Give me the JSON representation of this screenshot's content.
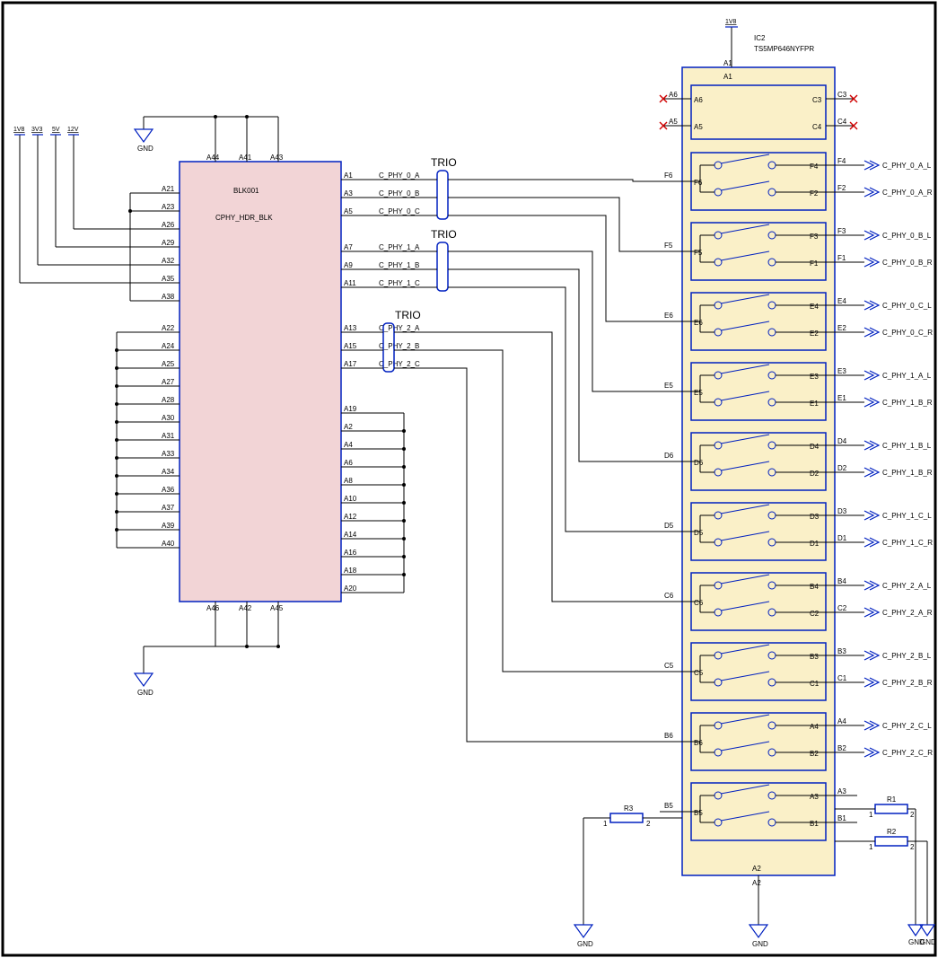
{
  "power_rails": [
    "1V8",
    "3V3",
    "5V",
    "12V"
  ],
  "gnd_label": "GND",
  "block_left": {
    "refdes": "BLK001",
    "type": "CPHY_HDR_BLK",
    "left_pins_top": [
      "A21",
      "A23",
      "A26",
      "A29",
      "A32",
      "A35",
      "A38"
    ],
    "left_pins_bottom": [
      "A22",
      "A24",
      "A25",
      "A27",
      "A28",
      "A30",
      "A31",
      "A33",
      "A34",
      "A36",
      "A37",
      "A39",
      "A40"
    ],
    "right_pins_trios": [
      "A1",
      "A3",
      "A5",
      "A7",
      "A9",
      "A11",
      "A13",
      "A15",
      "A17"
    ],
    "right_pins_bottom": [
      "A19",
      "A2",
      "A4",
      "A6",
      "A8",
      "A10",
      "A12",
      "A14",
      "A16",
      "A18",
      "A20"
    ],
    "top_pins": [
      "A44",
      "A41",
      "A43"
    ],
    "bottom_pins": [
      "A46",
      "A42",
      "A45"
    ]
  },
  "trio_label": "TRIO",
  "cphy_nets": [
    "C_PHY_0_A",
    "C_PHY_0_B",
    "C_PHY_0_C",
    "C_PHY_1_A",
    "C_PHY_1_B",
    "C_PHY_1_C",
    "C_PHY_2_A",
    "C_PHY_2_B",
    "C_PHY_2_C"
  ],
  "ic_right": {
    "refdes": "IC2",
    "part": "TS5MP646NYFPR",
    "top_pin": "A1",
    "bottom_pin": "A2",
    "power_top": "1V8",
    "nc_left": [
      "A6",
      "A5"
    ],
    "nc_right": [
      "C3",
      "C4"
    ],
    "left_inputs": [
      "F6",
      "F5",
      "E6",
      "E5",
      "D6",
      "D5",
      "C6",
      "C5",
      "B6",
      "B5"
    ],
    "right_outputs": [
      [
        "F4",
        "F2"
      ],
      [
        "F3",
        "F1"
      ],
      [
        "E4",
        "E2"
      ],
      [
        "E3",
        "E1"
      ],
      [
        "D4",
        "D2"
      ],
      [
        "D3",
        "D1"
      ],
      [
        "B4",
        "C2"
      ],
      [
        "B3",
        "C1"
      ],
      [
        "A4",
        "B2"
      ],
      [
        "A3",
        "B1"
      ]
    ]
  },
  "out_ports": [
    "C_PHY_0_A_L",
    "C_PHY_0_A_R",
    "C_PHY_0_B_L",
    "C_PHY_0_B_R",
    "C_PHY_0_C_L",
    "C_PHY_0_C_R",
    "C_PHY_1_A_L",
    "C_PHY_1_B_R",
    "C_PHY_1_B_L",
    "C_PHY_1_B_R",
    "C_PHY_1_C_L",
    "C_PHY_1_C_R",
    "C_PHY_2_A_L",
    "C_PHY_2_A_R",
    "C_PHY_2_B_L",
    "C_PHY_2_B_R",
    "C_PHY_2_C_L",
    "C_PHY_2_C_R"
  ],
  "resistors": [
    "R1",
    "R2",
    "R3"
  ],
  "res_pins": [
    "1",
    "2"
  ]
}
